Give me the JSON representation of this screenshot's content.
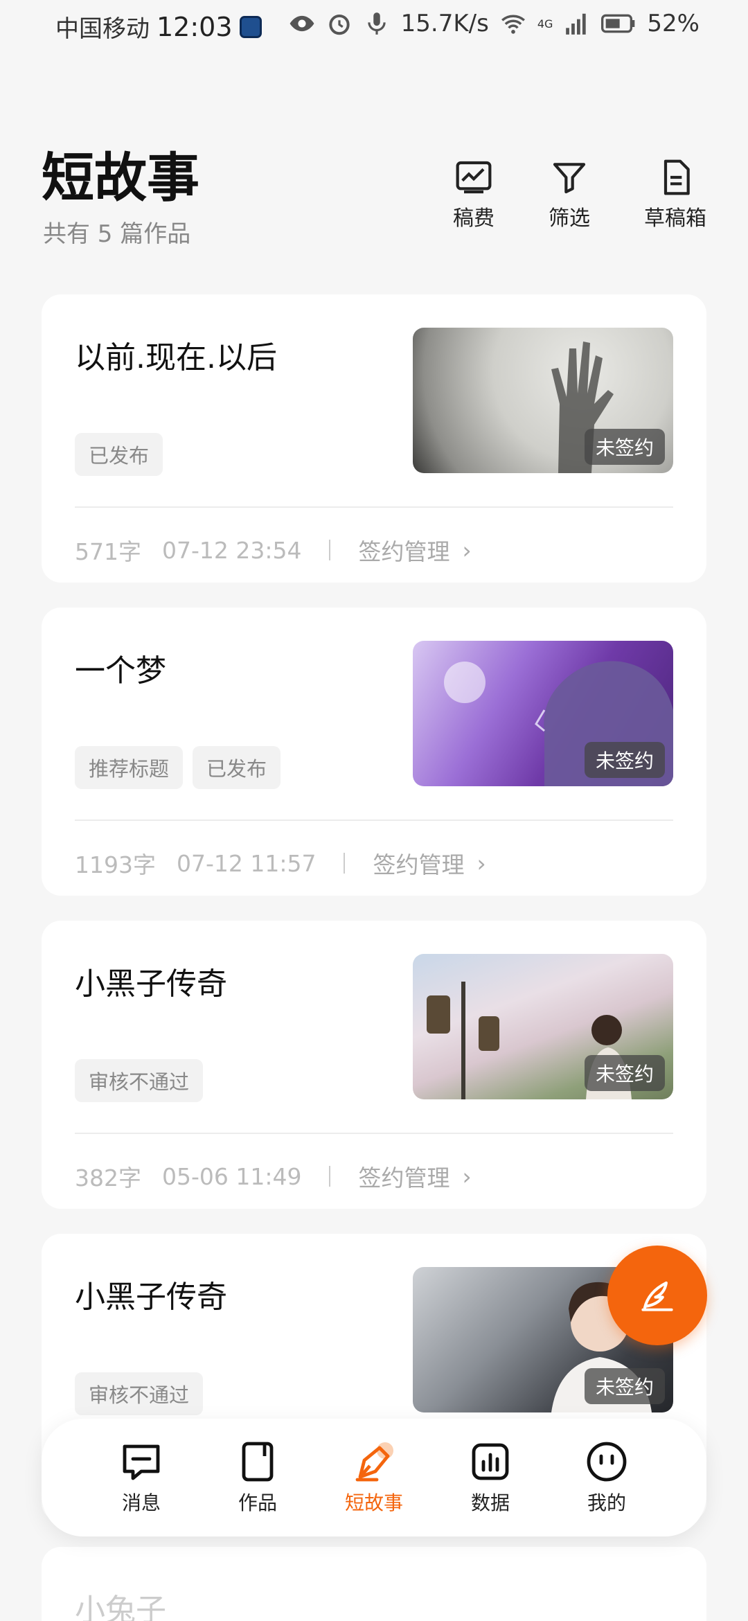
{
  "status_bar": {
    "carrier": "中国移动",
    "time": "12:03",
    "speed": "15.7K/s",
    "network": "4G",
    "battery": "52%"
  },
  "header": {
    "title": "短故事",
    "subtitle": "共有 5 篇作品",
    "actions": [
      {
        "label": "稿费",
        "icon": "chart-line-icon"
      },
      {
        "label": "筛选",
        "icon": "filter-icon"
      },
      {
        "label": "草稿箱",
        "icon": "draft-file-icon"
      }
    ]
  },
  "stories": [
    {
      "title": "以前.现在.以后",
      "tags": [
        "已发布"
      ],
      "badge": "未签约",
      "words": "571字",
      "date": "07-12 23:54",
      "sign_label": "签约管理"
    },
    {
      "title": "一个梦",
      "tags": [
        "推荐标题",
        "已发布"
      ],
      "badge": "未签约",
      "words": "1193字",
      "date": "07-12 11:57",
      "sign_label": "签约管理"
    },
    {
      "title": "小黑子传奇",
      "tags": [
        "审核不通过"
      ],
      "badge": "未签约",
      "words": "382字",
      "date": "05-06 11:49",
      "sign_label": "签约管理"
    },
    {
      "title": "小黑子传奇",
      "tags": [
        "审核不通过"
      ],
      "badge": "未签约"
    },
    {
      "title": "小兔子"
    }
  ],
  "bottom_nav": [
    {
      "label": "消息",
      "icon": "message-icon",
      "active": false
    },
    {
      "label": "作品",
      "icon": "works-icon",
      "active": false
    },
    {
      "label": "短故事",
      "icon": "pen-icon",
      "active": true
    },
    {
      "label": "数据",
      "icon": "data-chart-icon",
      "active": false
    },
    {
      "label": "我的",
      "icon": "profile-face-icon",
      "active": false
    }
  ],
  "fab": {
    "icon": "quill-icon"
  },
  "colors": {
    "accent": "#f4650d",
    "background": "#f6f6f6",
    "card": "#ffffff"
  }
}
